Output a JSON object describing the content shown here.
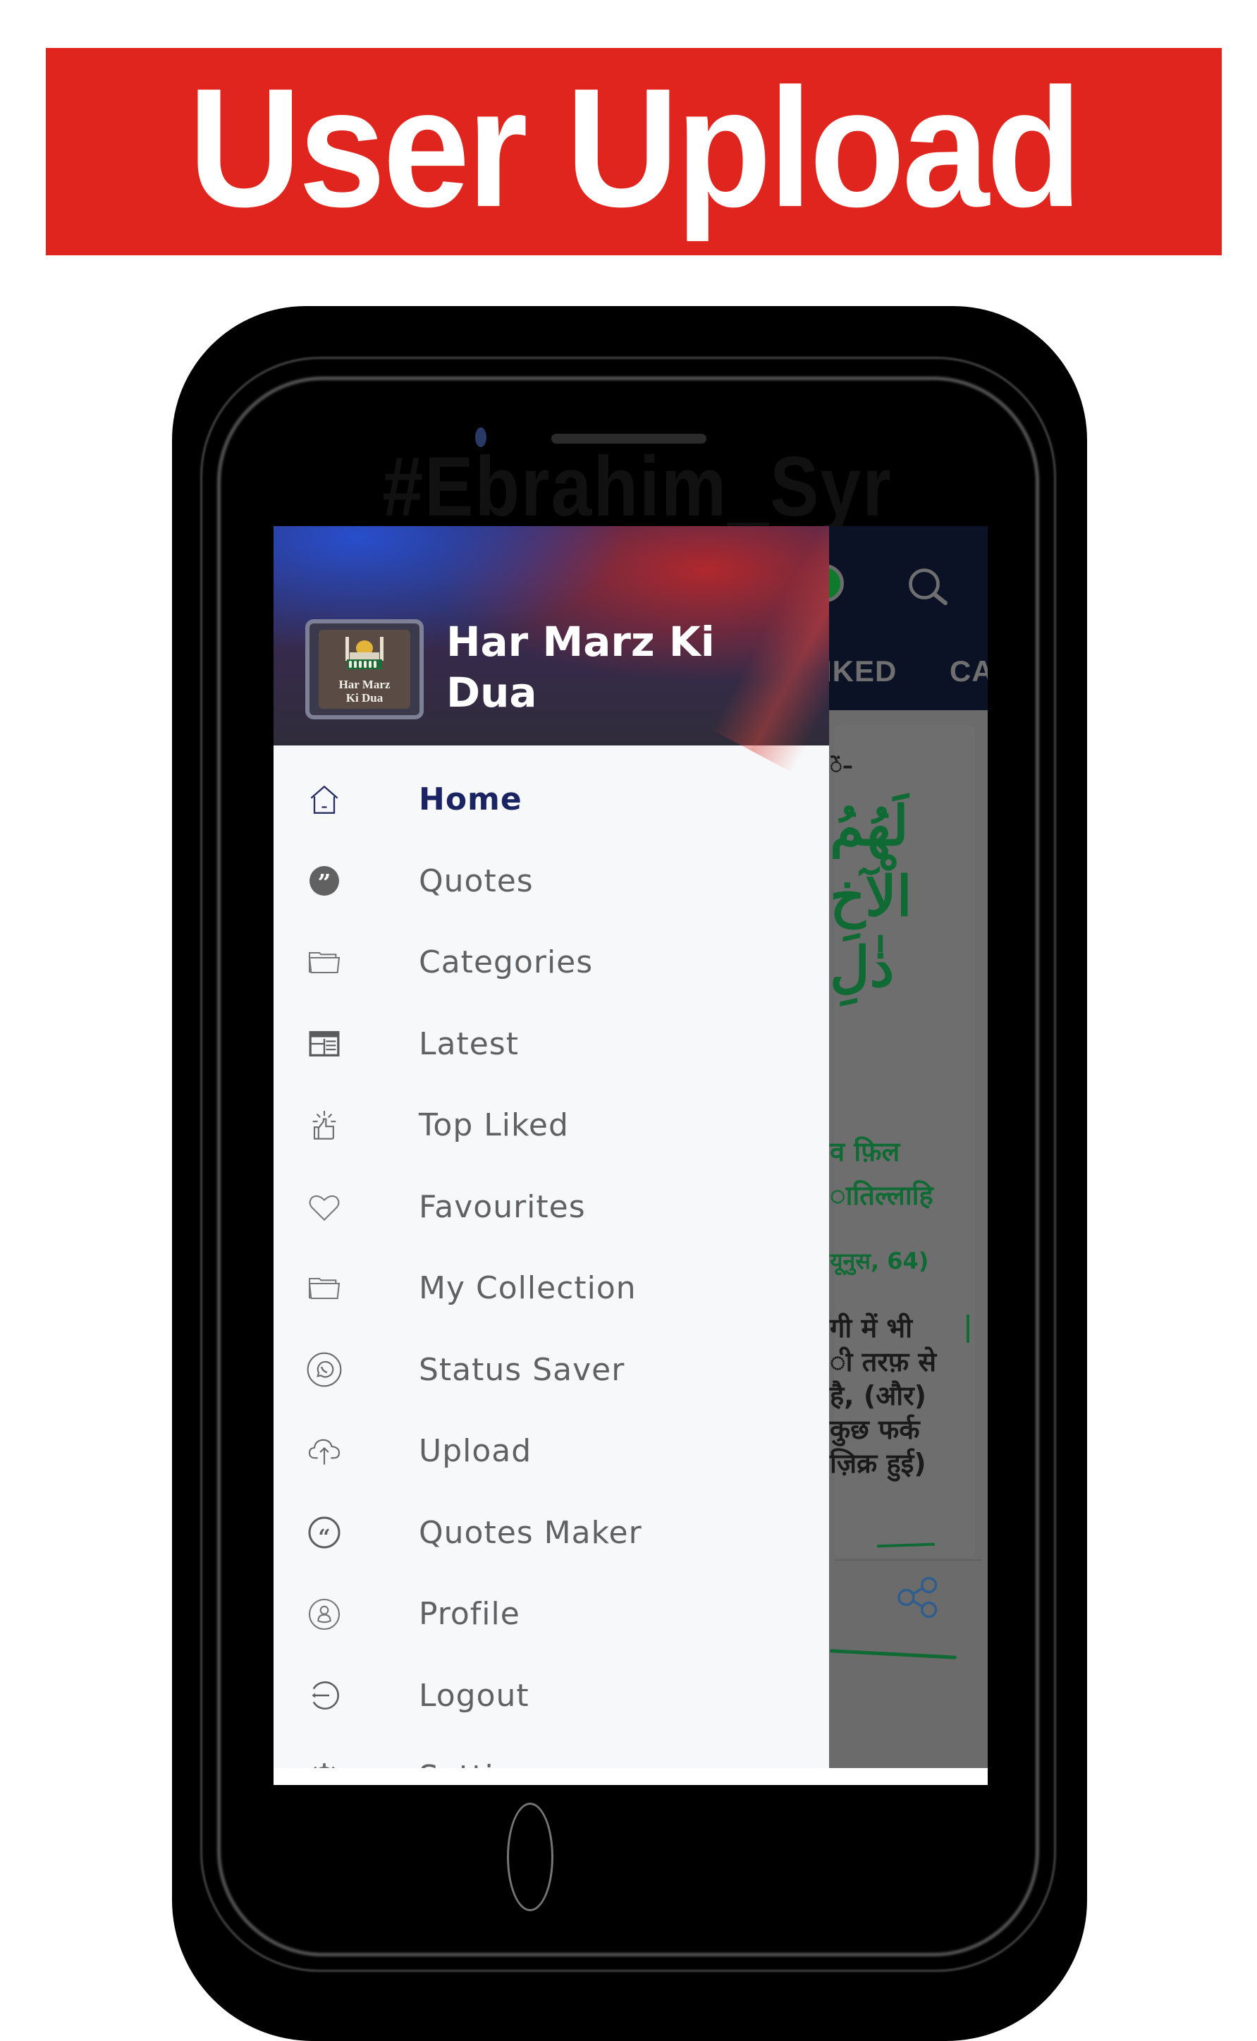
{
  "banner": {
    "title": "User Upload"
  },
  "phone": {
    "watermark": "#Ebrahim_Syr"
  },
  "background_app": {
    "tabs": [
      "IKED",
      "CA"
    ],
    "arabic_lines": [
      "لَهُمُ",
      "الْآخِ",
      "ذٰلِ"
    ],
    "hindi_lines_green": [
      "व   फ़िल",
      "ातिल्लाहि"
    ],
    "reference": "यूनुस, 64)",
    "hindi_lines_dark": [
      "गी में भी",
      "ी तरफ़ से",
      "है, (और)",
      "कुछ फर्क",
      "ज़िक्र हुई)"
    ],
    "colors": {
      "toolbar": "#0c1226",
      "text_green": "#0f6a34",
      "scrim": "#6b6b6b"
    }
  },
  "drawer": {
    "app_title": "Har Marz Ki Dua",
    "logo": {
      "line1": "Har Marz",
      "line2": "Ki Dua"
    },
    "items": [
      {
        "label": "Home",
        "icon": "home-icon",
        "active": true
      },
      {
        "label": "Quotes",
        "icon": "quote-bubble-icon"
      },
      {
        "label": "Categories",
        "icon": "folder-icon"
      },
      {
        "label": "Latest",
        "icon": "newspaper-icon"
      },
      {
        "label": "Top Liked",
        "icon": "thumbs-up-icon"
      },
      {
        "label": "Favourites",
        "icon": "heart-icon"
      },
      {
        "label": "My Collection",
        "icon": "folder-icon"
      },
      {
        "label": "Status Saver",
        "icon": "whatsapp-icon"
      },
      {
        "label": "Upload",
        "icon": "cloud-upload-icon"
      },
      {
        "label": "Quotes Maker",
        "icon": "quote-circle-icon"
      },
      {
        "label": "Profile",
        "icon": "profile-icon"
      },
      {
        "label": "Logout",
        "icon": "logout-icon"
      },
      {
        "label": "Settings",
        "icon": "gear-icon"
      }
    ],
    "colors": {
      "active_text": "#1b2462",
      "text": "#616161",
      "background": "#f7f8fa"
    }
  }
}
